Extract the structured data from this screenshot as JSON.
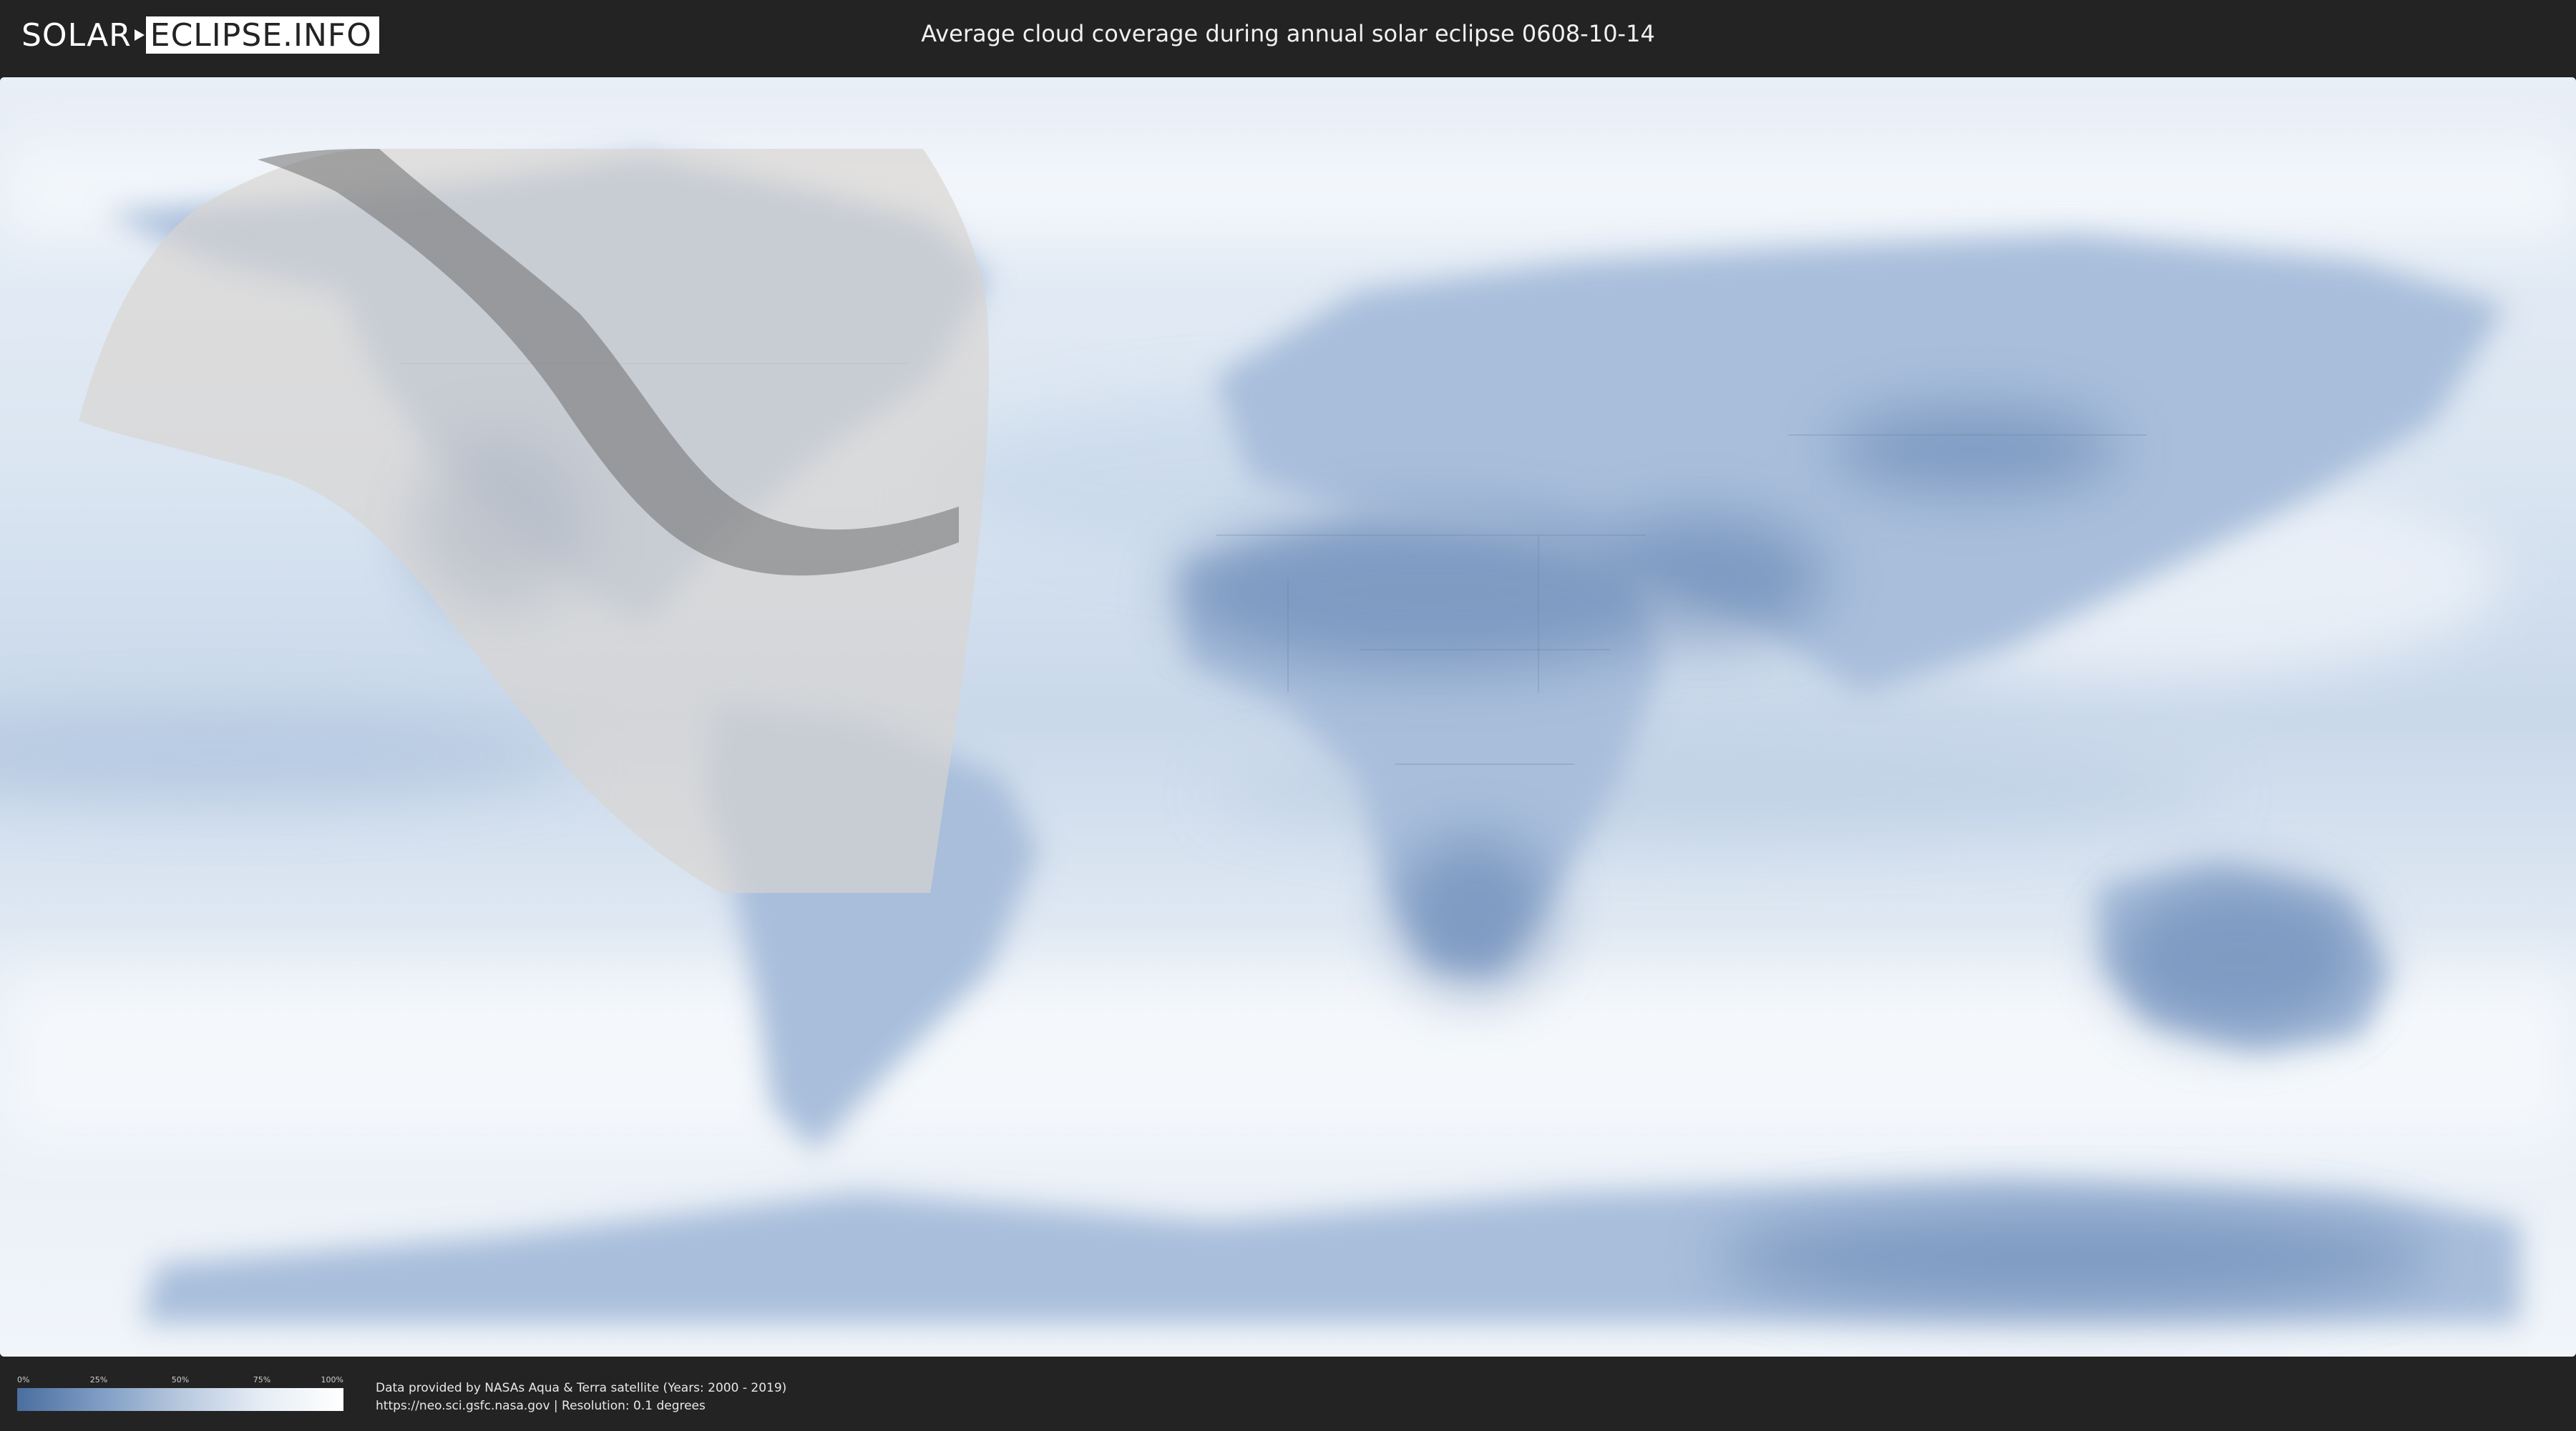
{
  "header": {
    "logo_left": "SOLAR",
    "logo_right": "ECLIPSE.INFO",
    "title": "Average cloud coverage during annual solar eclipse 0608-10-14"
  },
  "legend": {
    "ticks": [
      "0%",
      "25%",
      "50%",
      "75%",
      "100%"
    ],
    "colors": {
      "low": "#4a6e9f",
      "mid": "#b7c8de",
      "high": "#ffffff"
    }
  },
  "credits": {
    "line1": "Data provided by NASAs Aqua & Terra satellite (Years: 2000 - 2019)",
    "line2": "https://neo.sci.gsfc.nasa.gov | Resolution: 0.1 degrees"
  },
  "map": {
    "ocean_color": "#dfe9f4",
    "land_color": "#9fb6d3",
    "clear_sky_color": "#5e7fae",
    "penumbra_color": "#d8d4d0",
    "umbra_color": "#6f6f6f"
  }
}
